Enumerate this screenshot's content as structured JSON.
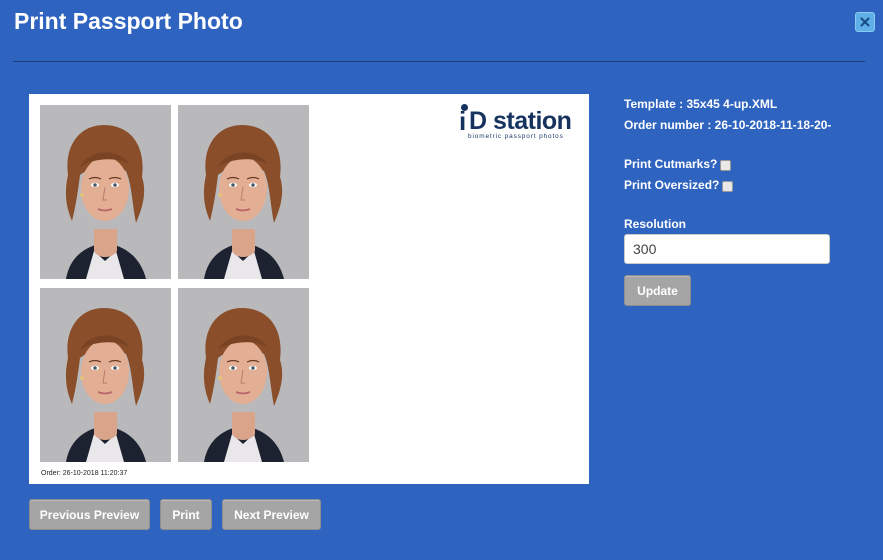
{
  "dialog": {
    "title": "Print Passport Photo"
  },
  "preview": {
    "logo": {
      "brand": "iD station",
      "brand_word": "station",
      "tagline": "biometric passport photos"
    },
    "order_caption": "Order: 26-10-2018 11:20:37",
    "photo_count": 4
  },
  "info": {
    "template": "Template : 35x45 4-up.XML",
    "order_number": "Order number : 26-10-2018-11-18-20-"
  },
  "options": {
    "print_cutmarks_label": "Print Cutmarks?",
    "print_cutmarks_checked": false,
    "print_oversized_label": "Print Oversized?",
    "print_oversized_checked": false
  },
  "resolution": {
    "label": "Resolution",
    "value": "300"
  },
  "buttons": {
    "update": "Update",
    "previous_preview": "Previous Preview",
    "print": "Print",
    "next_preview": "Next Preview"
  },
  "icons": {
    "close": "close-icon"
  },
  "colors": {
    "background": "#2f63c0",
    "button": "#a5a5a5",
    "close_button": "#5fb0e8",
    "logo": "#16335f"
  }
}
